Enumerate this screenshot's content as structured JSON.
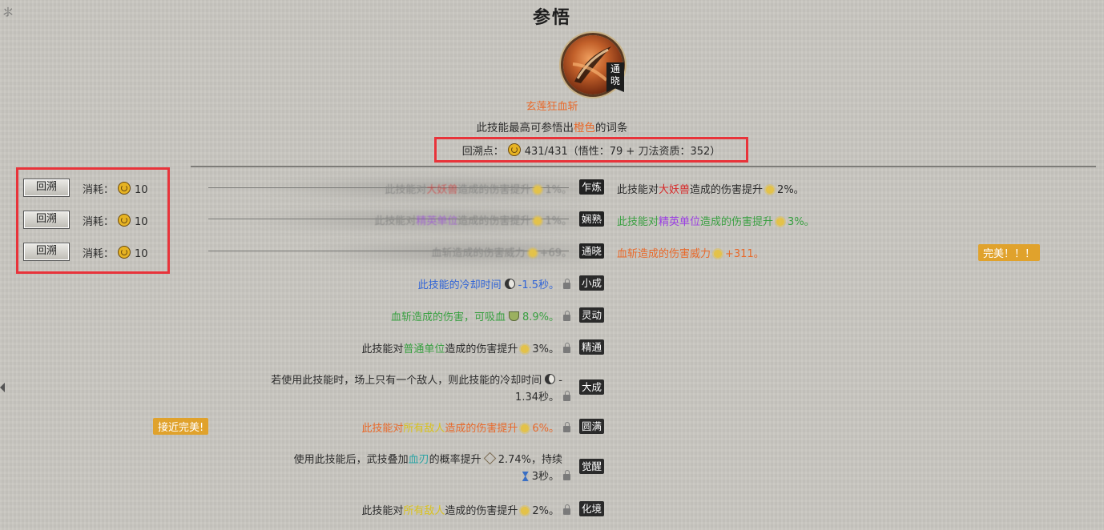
{
  "header": {
    "title": "参悟",
    "skill_name": "玄莲狂血斩",
    "rank_badge": "通晓",
    "desc_before": "此技能最高可参悟出",
    "desc_highlight": "橙色",
    "desc_after": "的词条",
    "points_label": "回溯点：",
    "points_value": "431/431（悟性：79 + 刀法资质：352）"
  },
  "rerolls": [
    {
      "button": "回溯",
      "cost_label": "消耗：",
      "cost_value": "10",
      "old_a": "此技能对",
      "old_hl": "大妖兽",
      "old_b": "造成的伤害提升",
      "old_val": "1%。",
      "tag": "乍炼",
      "new_a": "此技能对",
      "new_hl": "大妖兽",
      "new_b": "造成的伤害提升",
      "new_val": "2%。"
    },
    {
      "button": "回溯",
      "cost_label": "消耗：",
      "cost_value": "10",
      "old_a": "此技能对",
      "old_hl": "精英单位",
      "old_b": "造成的伤害提升",
      "old_val": "1%。",
      "tag": "娴熟",
      "new_a": "此技能对",
      "new_hl": "精英单位",
      "new_b": "造成的伤害提升",
      "new_val": "3%。"
    },
    {
      "button": "回溯",
      "cost_label": "消耗：",
      "cost_value": "10",
      "old_a": "",
      "old_hl": "",
      "old_b": "血斩造成的伤害威力",
      "old_val": "+69。",
      "tag": "通晓",
      "new_a": "",
      "new_hl": "",
      "new_b": "血斩造成的伤害威力",
      "new_val": "+311。",
      "perfect": "完美！！！"
    }
  ],
  "locked": [
    {
      "text": "此技能的冷却时间",
      "val": "-1.5秒。",
      "tag": "小成"
    },
    {
      "text": "血斩造成的伤害，可吸血",
      "val": "8.9%。",
      "tag": "灵动"
    },
    {
      "a": "此技能对",
      "hl": "普通单位",
      "b": "造成的伤害提升",
      "val": "3%。",
      "tag": "精通"
    },
    {
      "line1": "若使用此技能时，场上只有一个敌人，则此技能的冷却时间",
      "line1_tail": "-",
      "line2": "1.34秒。",
      "tag": "大成"
    },
    {
      "a": "此技能对",
      "hl": "所有敌人",
      "b": "造成的伤害提升",
      "val": "6%。",
      "tag": "圆满",
      "badge": "接近完美!"
    },
    {
      "line1": "使用此技能后，武技叠加",
      "line1_hl": "血刃",
      "line1_b": "的概率提升",
      "line1_val": "2.74%，持续",
      "line2": "3秒。",
      "tag": "觉醒"
    },
    {
      "a": "此技能对",
      "hl": "所有敌人",
      "b": "造成的伤害提升",
      "val": "2%。",
      "tag": "化境"
    }
  ],
  "colors": {
    "highlight_box": "#e8333a",
    "orange": "#e8692a",
    "gold_badge": "#e0a22c"
  }
}
